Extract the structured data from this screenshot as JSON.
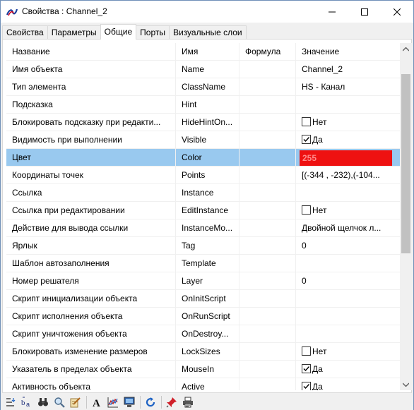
{
  "window": {
    "title": "Свойства :  Channel_2"
  },
  "tabs": [
    {
      "label": "Свойства"
    },
    {
      "label": "Параметры"
    },
    {
      "label": "Общие"
    },
    {
      "label": "Порты"
    },
    {
      "label": "Визуальные слои"
    }
  ],
  "active_tab": "Общие",
  "grid": {
    "columns": [
      "Название",
      "Имя",
      "Формула",
      "Значение"
    ],
    "rows": [
      {
        "title": "Имя объекта",
        "name": "Name",
        "formula": "",
        "value": "Channel_2"
      },
      {
        "title": "Тип элемента",
        "name": "ClassName",
        "formula": "",
        "value": "HS - Канал"
      },
      {
        "title": "Подсказка",
        "name": "Hint",
        "formula": "",
        "value": ""
      },
      {
        "title": "Блокировать подсказку при редакти...",
        "name": "HideHintOn...",
        "formula": "",
        "value": "Нет",
        "checkbox": false
      },
      {
        "title": "Видимость при выполнении",
        "name": "Visible",
        "formula": "",
        "value": "Да",
        "checkbox": true
      },
      {
        "title": "Цвет",
        "name": "Color",
        "formula": "",
        "value": "255",
        "color": "#ee1111"
      },
      {
        "title": "Координаты точек",
        "name": "Points",
        "formula": "",
        "value": "[(-344 , -232),(-104..."
      },
      {
        "title": "Ссылка",
        "name": "Instance",
        "formula": "",
        "value": ""
      },
      {
        "title": "Ссылка при редактировании",
        "name": "EditInstance",
        "formula": "",
        "value": "Нет",
        "checkbox": false
      },
      {
        "title": "Действие для вывода ссылки",
        "name": "InstanceMo...",
        "formula": "",
        "value": "Двойной щелчок л..."
      },
      {
        "title": "Ярлык",
        "name": "Tag",
        "formula": "",
        "value": "0"
      },
      {
        "title": "Шаблон автозаполнения",
        "name": "Template",
        "formula": "",
        "value": ""
      },
      {
        "title": "Номер решателя",
        "name": "Layer",
        "formula": "",
        "value": "0"
      },
      {
        "title": "Скрипт инициализации объекта",
        "name": "OnInitScript",
        "formula": "",
        "value": ""
      },
      {
        "title": "Скрипт исполнения объекта",
        "name": "OnRunScript",
        "formula": "",
        "value": ""
      },
      {
        "title": "Скрипт уничтожения объекта",
        "name": "OnDestroy...",
        "formula": "",
        "value": ""
      },
      {
        "title": "Блокировать изменение размеров",
        "name": "LockSizes",
        "formula": "",
        "value": "Нет",
        "checkbox": false
      },
      {
        "title": "Указатель в пределах объекта",
        "name": "MouseIn",
        "formula": "",
        "value": "Да",
        "checkbox": true
      },
      {
        "title": "Активность объекта",
        "name": "Active",
        "formula": "",
        "value": "Да",
        "checkbox": true
      }
    ],
    "selected_row": "Цвет"
  },
  "toolbar": {
    "buttons": [
      "sort-icon",
      "sort-alpha-icon",
      "binoculars-icon",
      "magnifier-icon",
      "notepad-icon",
      "font-icon",
      "chart-icon",
      "monitor-icon",
      "refresh-icon",
      "pin-icon",
      "printer-icon"
    ]
  },
  "colors": {
    "selection": "#99c9ef",
    "color_value": "#ee1111"
  }
}
